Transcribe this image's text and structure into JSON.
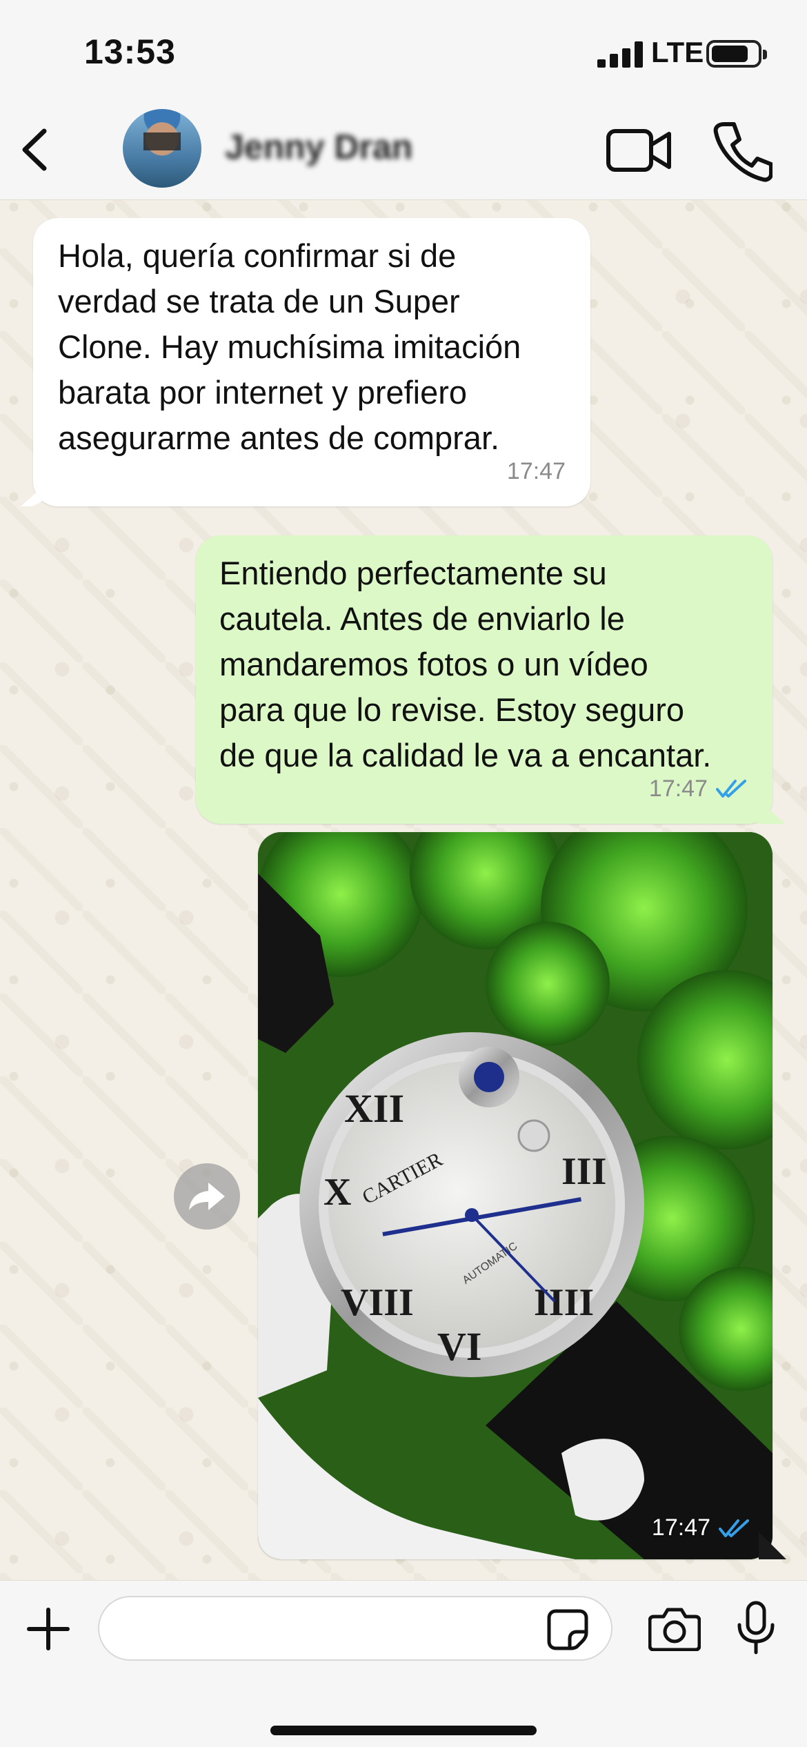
{
  "status_bar": {
    "time": "13:53",
    "network": "LTE"
  },
  "header": {
    "contact_name": "Jenny Dran",
    "back_icon": "chevron-left-icon",
    "video_icon": "video-camera-icon",
    "call_icon": "phone-icon"
  },
  "messages": [
    {
      "direction": "incoming",
      "text": "Hola, quería confirmar si de\nverdad se trata de un Super\nClone. Hay muchísima imitación\nbarata por internet y prefiero\nasegurarme antes de comprar.",
      "time": "17:47"
    },
    {
      "direction": "outgoing",
      "text": "Entiendo perfectamente su\ncautela. Antes de enviarlo le\nmandaremos fotos o un vídeo\npara que lo revise. Estoy seguro\nde que la calidad le va a encantar.",
      "time": "17:47",
      "status": "read"
    },
    {
      "direction": "outgoing",
      "type": "image",
      "image_text": "CARTIER",
      "image_subtext": "AUTOMATIC",
      "time": "17:47",
      "status": "read"
    }
  ],
  "composer": {
    "input_value": "",
    "input_placeholder": "",
    "plus_icon": "plus-icon",
    "sticker_icon": "sticker-icon",
    "camera_icon": "camera-icon",
    "mic_icon": "microphone-icon"
  },
  "colors": {
    "incoming_bubble": "#ffffff",
    "outgoing_bubble": "#dcf8c6",
    "read_ticks": "#34a0ea",
    "wallpaper": "#f3efe6"
  }
}
